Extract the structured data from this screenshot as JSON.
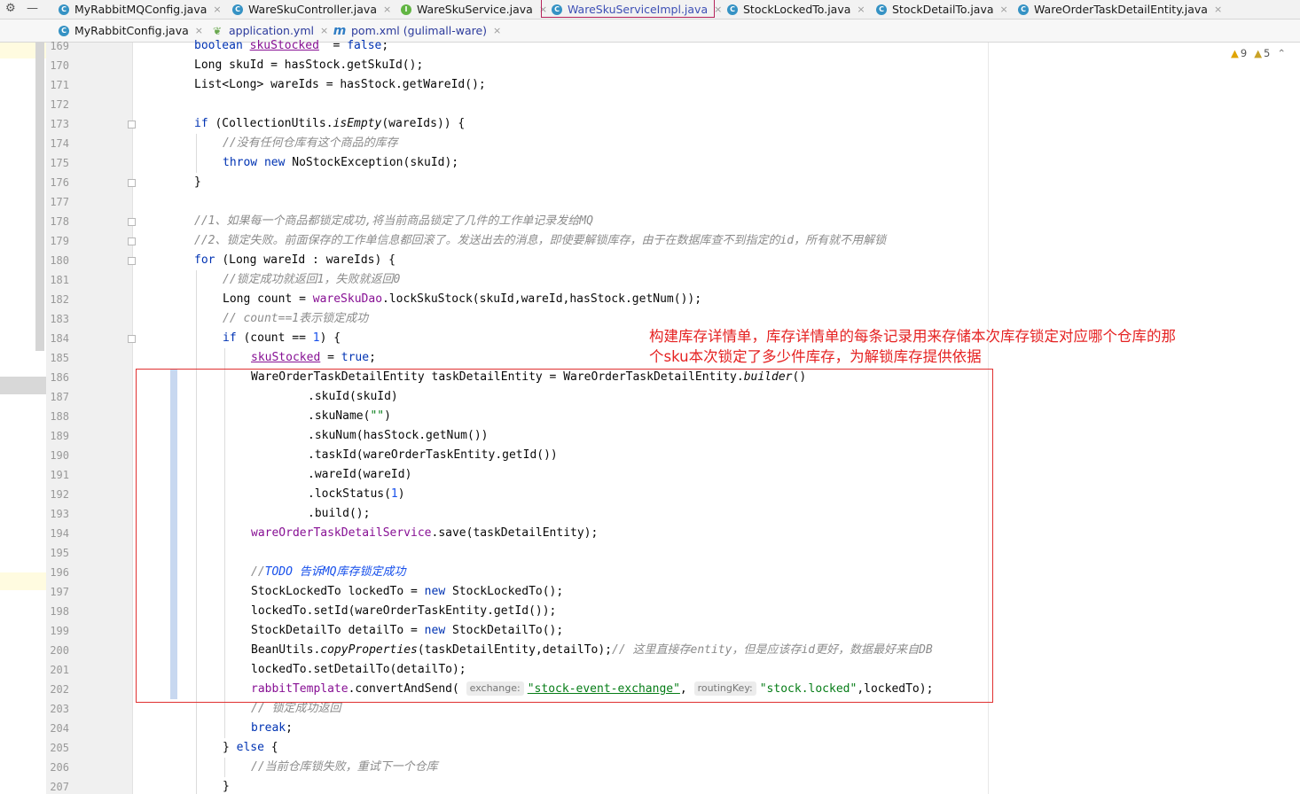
{
  "tabs_row1": [
    {
      "label": "MyRabbitMQConfig.java",
      "icon": "class-icon",
      "active": false
    },
    {
      "label": "WareSkuController.java",
      "icon": "class-icon",
      "active": false
    },
    {
      "label": "WareSkuService.java",
      "icon": "interface-icon",
      "active": false
    },
    {
      "label": "WareSkuServiceImpl.java",
      "icon": "class-icon",
      "active": true
    },
    {
      "label": "StockLockedTo.java",
      "icon": "class-icon",
      "active": false
    },
    {
      "label": "StockDetailTo.java",
      "icon": "class-icon",
      "active": false
    },
    {
      "label": "WareOrderTaskDetailEntity.java",
      "icon": "class-icon",
      "active": false
    }
  ],
  "tabs_row2": [
    {
      "label": "MyRabbitConfig.java",
      "icon": "class-icon"
    },
    {
      "label": "application.yml",
      "icon": "yaml-icon"
    },
    {
      "label": "pom.xml (gulimall-ware)",
      "icon": "maven-icon"
    }
  ],
  "icon_glyphs": {
    "class-icon": "C",
    "interface-icon": "I",
    "yaml-icon": "❦",
    "maven-icon": "m",
    "close-icon": "×",
    "gear-icon": "⚙",
    "minimize-icon": "—"
  },
  "inspections": {
    "warnings": "9",
    "weak_warnings": "5"
  },
  "annotation": {
    "text": "构建库存详情单，库存详情单的每条记录用来存储本次库存锁定对应哪个仓库的那个sku本次锁定了多少件库存，为解锁库存提供依据",
    "color": "#e52222"
  },
  "colors": {
    "keyword": "#0033b3",
    "field": "#871094",
    "string": "#067d17",
    "number": "#1750eb",
    "comment": "#8c8c8c",
    "annotation_red": "#e03030",
    "active_tab_border": "#b6245b"
  },
  "code_lines": [
    {
      "n": "169",
      "indent": 2,
      "tokens": [
        [
          "kw",
          "boolean "
        ],
        [
          "fld ul",
          "skuStocked"
        ],
        [
          "",
          "  = "
        ],
        [
          "kw",
          "false"
        ],
        [
          "",
          ";"
        ]
      ]
    },
    {
      "n": "170",
      "indent": 2,
      "tokens": [
        [
          "",
          "Long skuId = hasStock.getSkuId();"
        ]
      ]
    },
    {
      "n": "171",
      "indent": 2,
      "tokens": [
        [
          "",
          "List<Long> wareIds = hasStock.getWareId();"
        ]
      ]
    },
    {
      "n": "172",
      "indent": 2,
      "tokens": []
    },
    {
      "n": "173",
      "indent": 2,
      "tokens": [
        [
          "kw",
          "if "
        ],
        [
          "",
          "(CollectionUtils."
        ],
        [
          "it",
          "isEmpty"
        ],
        [
          "",
          "(wareIds)) {"
        ]
      ]
    },
    {
      "n": "174",
      "indent": 3,
      "tokens": [
        [
          "cm",
          "//没有任何仓库有这个商品的库存"
        ]
      ]
    },
    {
      "n": "175",
      "indent": 3,
      "tokens": [
        [
          "kw",
          "throw new "
        ],
        [
          "",
          "NoStockException(skuId);"
        ]
      ]
    },
    {
      "n": "176",
      "indent": 2,
      "tokens": [
        [
          "",
          "}"
        ]
      ]
    },
    {
      "n": "177",
      "indent": 2,
      "tokens": []
    },
    {
      "n": "178",
      "indent": 2,
      "tokens": [
        [
          "cm",
          "//1、如果每一个商品都锁定成功,将当前商品锁定了几件的工作单记录发给MQ"
        ]
      ]
    },
    {
      "n": "179",
      "indent": 2,
      "tokens": [
        [
          "cm",
          "//2、锁定失败。前面保存的工作单信息都回滚了。发送出去的消息，即使要解锁库存，由于在数据库查不到指定的id，所有就不用解锁"
        ]
      ]
    },
    {
      "n": "180",
      "indent": 2,
      "tokens": [
        [
          "kw",
          "for "
        ],
        [
          "",
          "(Long wareId : wareIds) {"
        ]
      ]
    },
    {
      "n": "181",
      "indent": 3,
      "tokens": [
        [
          "cm",
          "//锁定成功就返回1，失败就返回0"
        ]
      ]
    },
    {
      "n": "182",
      "indent": 3,
      "tokens": [
        [
          "",
          "Long count = "
        ],
        [
          "fld",
          "wareSkuDao"
        ],
        [
          "",
          ".lockSkuStock(skuId,wareId,hasStock.getNum());"
        ]
      ]
    },
    {
      "n": "183",
      "indent": 3,
      "tokens": [
        [
          "cm",
          "// count==1表示锁定成功"
        ]
      ]
    },
    {
      "n": "184",
      "indent": 3,
      "tokens": [
        [
          "kw",
          "if "
        ],
        [
          "",
          "(count == "
        ],
        [
          "num",
          "1"
        ],
        [
          "",
          ") {"
        ]
      ]
    },
    {
      "n": "185",
      "indent": 4,
      "tokens": [
        [
          "fld ul",
          "skuStocked"
        ],
        [
          "",
          " = "
        ],
        [
          "kw",
          "true"
        ],
        [
          "",
          ";"
        ]
      ]
    },
    {
      "n": "186",
      "indent": 4,
      "tokens": [
        [
          "",
          "WareOrderTaskDetailEntity taskDetailEntity = WareOrderTaskDetailEntity."
        ],
        [
          "it",
          "builder"
        ],
        [
          "",
          "()"
        ]
      ]
    },
    {
      "n": "187",
      "indent": 6,
      "tokens": [
        [
          "",
          ".skuId(skuId)"
        ]
      ]
    },
    {
      "n": "188",
      "indent": 6,
      "tokens": [
        [
          "",
          ".skuName("
        ],
        [
          "str",
          "\"\""
        ],
        [
          "",
          ")"
        ]
      ]
    },
    {
      "n": "189",
      "indent": 6,
      "tokens": [
        [
          "",
          ".skuNum(hasStock.getNum())"
        ]
      ]
    },
    {
      "n": "190",
      "indent": 6,
      "tokens": [
        [
          "",
          ".taskId(wareOrderTaskEntity.getId())"
        ]
      ]
    },
    {
      "n": "191",
      "indent": 6,
      "tokens": [
        [
          "",
          ".wareId(wareId)"
        ]
      ]
    },
    {
      "n": "192",
      "indent": 6,
      "tokens": [
        [
          "",
          ".lockStatus("
        ],
        [
          "num",
          "1"
        ],
        [
          "",
          ")"
        ]
      ]
    },
    {
      "n": "193",
      "indent": 6,
      "tokens": [
        [
          "",
          ".build();"
        ]
      ]
    },
    {
      "n": "194",
      "indent": 4,
      "tokens": [
        [
          "fld",
          "wareOrderTaskDetailService"
        ],
        [
          "",
          ".save(taskDetailEntity);"
        ]
      ]
    },
    {
      "n": "195",
      "indent": 4,
      "tokens": []
    },
    {
      "n": "196",
      "indent": 4,
      "tokens": [
        [
          "cm",
          "//"
        ],
        [
          "todo",
          "TODO 告诉MQ库存锁定成功"
        ]
      ]
    },
    {
      "n": "197",
      "indent": 4,
      "tokens": [
        [
          "",
          "StockLockedTo lockedTo = "
        ],
        [
          "kw",
          "new "
        ],
        [
          "",
          "StockLockedTo();"
        ]
      ]
    },
    {
      "n": "198",
      "indent": 4,
      "tokens": [
        [
          "",
          "lockedTo.setId(wareOrderTaskEntity.getId());"
        ]
      ]
    },
    {
      "n": "199",
      "indent": 4,
      "tokens": [
        [
          "",
          "StockDetailTo detailTo = "
        ],
        [
          "kw",
          "new "
        ],
        [
          "",
          "StockDetailTo();"
        ]
      ]
    },
    {
      "n": "200",
      "indent": 4,
      "tokens": [
        [
          "",
          "BeanUtils."
        ],
        [
          "it",
          "copyProperties"
        ],
        [
          "",
          "(taskDetailEntity,detailTo);"
        ],
        [
          "cm",
          "// 这里直接存entity，但是应该存id更好，数据最好来自DB"
        ]
      ]
    },
    {
      "n": "201",
      "indent": 4,
      "tokens": [
        [
          "",
          "lockedTo.setDetailTo(detailTo);"
        ]
      ]
    },
    {
      "n": "202",
      "indent": 4,
      "tokens": [
        [
          "fld",
          "rabbitTemplate"
        ],
        [
          "",
          ".convertAndSend( "
        ],
        [
          "hint",
          "exchange:"
        ],
        [
          "str ul",
          "\"stock-event-exchange\""
        ],
        [
          "",
          ", "
        ],
        [
          "hint",
          "routingKey:"
        ],
        [
          "str",
          "\"stock.locked\""
        ],
        [
          "",
          ",lockedTo);"
        ]
      ]
    },
    {
      "n": "203",
      "indent": 4,
      "tokens": [
        [
          "cm",
          "// 锁定成功返回"
        ]
      ]
    },
    {
      "n": "204",
      "indent": 4,
      "tokens": [
        [
          "kw",
          "break"
        ],
        [
          "",
          ";"
        ]
      ]
    },
    {
      "n": "205",
      "indent": 3,
      "tokens": [
        [
          "",
          "} "
        ],
        [
          "kw",
          "else "
        ],
        [
          "",
          "{"
        ]
      ]
    },
    {
      "n": "206",
      "indent": 4,
      "tokens": [
        [
          "cm",
          "//当前仓库锁失败，重试下一个仓库"
        ]
      ]
    },
    {
      "n": "207",
      "indent": 3,
      "tokens": [
        [
          "",
          "}"
        ]
      ]
    }
  ]
}
